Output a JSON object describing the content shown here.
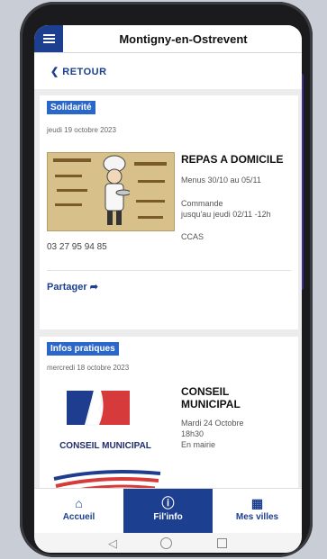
{
  "header": {
    "title": "Montigny-en-Ostrevent"
  },
  "nav": {
    "back_label": "RETOUR"
  },
  "posts": [
    {
      "category": "Solidarité",
      "date": "jeudi 19 octobre 2023",
      "title": "REPAS A DOMICILE",
      "lines": [
        "Menus 30/10 au 05/11",
        "Commande",
        "jusqu'au jeudi 02/11 -12h",
        "CCAS"
      ],
      "phone": "03 27 95 94 85",
      "share_label": "Partager"
    },
    {
      "category": "Infos pratiques",
      "date": "mercredi 18 octobre 2023",
      "title_line1": "CONSEIL",
      "title_line2": "MUNICIPAL",
      "lines": [
        "Mardi 24 Octobre",
        "18h30",
        "En mairie"
      ],
      "logo_text": "CONSEIL MUNICIPAL"
    }
  ],
  "bottom_nav": {
    "tabs": [
      {
        "label": "Accueil",
        "icon": "home-icon",
        "active": false
      },
      {
        "label": "Fil'info",
        "icon": "info-icon",
        "active": true
      },
      {
        "label": "Mes villes",
        "icon": "building-icon",
        "active": false
      }
    ]
  },
  "colors": {
    "primary": "#1d3f8f",
    "badge": "#2a67c9",
    "flag_blue": "#1f3d8f",
    "flag_red": "#d63a3a"
  }
}
